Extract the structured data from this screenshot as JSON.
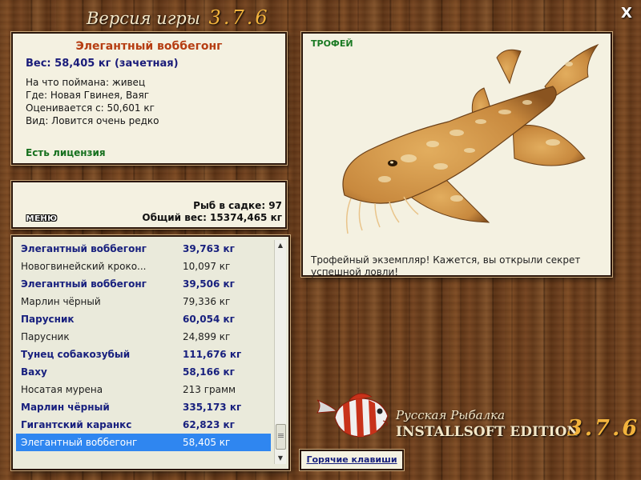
{
  "window": {
    "title": "Версия игры",
    "version": "3.7.6",
    "close_symbol": "X"
  },
  "fish_info": {
    "name": "Элегантный воббегонг",
    "weight": "Вес: 58,405 кг (зачетная)",
    "lines": [
      "На что поймана: живец",
      "Где: Новая Гвинея, Ваяг",
      "Оценивается с: 50,601 кг",
      "Вид: Ловится очень редко"
    ],
    "license": "Есть лицензия"
  },
  "stats": {
    "menu_label": "МЕНЮ",
    "fish_in_cage": "Рыб в садке: 97",
    "total_weight": "Общий вес: 15374,465 кг"
  },
  "catch_list": {
    "selected_index": 11,
    "rows": [
      {
        "name": "Элегантный воббегонг",
        "weight": "39,763 кг",
        "bold": true
      },
      {
        "name": "Новогвинейский кроко...",
        "weight": "10,097 кг",
        "bold": false
      },
      {
        "name": "Элегантный воббегонг",
        "weight": "39,506 кг",
        "bold": true
      },
      {
        "name": "Марлин чёрный",
        "weight": "79,336 кг",
        "bold": false
      },
      {
        "name": "Парусник",
        "weight": "60,054 кг",
        "bold": true
      },
      {
        "name": "Парусник",
        "weight": "24,899 кг",
        "bold": false
      },
      {
        "name": "Тунец собакозубый",
        "weight": "111,676 кг",
        "bold": true
      },
      {
        "name": "Ваху",
        "weight": "58,166 кг",
        "bold": true
      },
      {
        "name": "Носатая мурена",
        "weight": "213 грамм",
        "bold": false
      },
      {
        "name": "Марлин чёрный",
        "weight": "335,173 кг",
        "bold": true
      },
      {
        "name": "Гигантский каранкс",
        "weight": "62,823 кг",
        "bold": true
      },
      {
        "name": "Элегантный воббегонг",
        "weight": "58,405 кг",
        "bold": true
      }
    ]
  },
  "trophy": {
    "label": "ТРОФЕЙ",
    "text": "Трофейный экземпляр! Кажется, вы открыли секрет успешной ловли!",
    "fish_colors": {
      "body": "#c8893e",
      "spots": "#f1deb0",
      "outline": "#6a3f17"
    }
  },
  "logo": {
    "title": "Русская Рыбалка",
    "edition": "INSTALLSOFT EDITION",
    "version": "3.7.6"
  },
  "buttons": {
    "hotkeys": "Горячие клавиши"
  },
  "icons": {
    "close": "close-icon",
    "scroll_up": "chevron-up-icon",
    "scroll_down": "chevron-down-icon"
  }
}
